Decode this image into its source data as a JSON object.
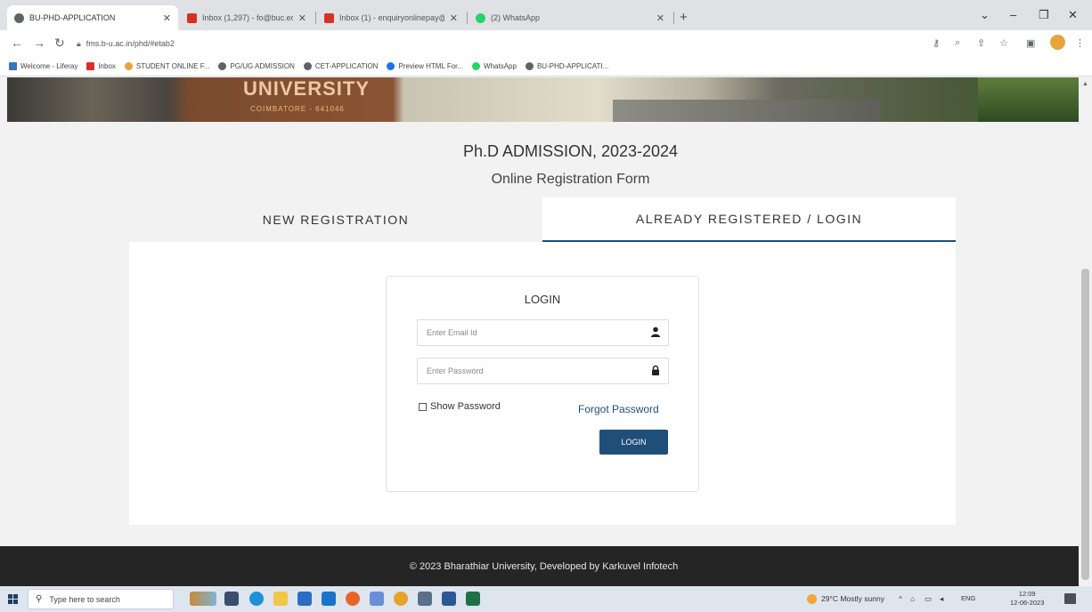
{
  "browser": {
    "tabs": [
      {
        "title": "BU-PHD-APPLICATION",
        "favicon_color": "#5f6368",
        "active": true
      },
      {
        "title": "Inbox (1,297) - fo@buc.edu.in - · ·",
        "favicon_color": "#d93025",
        "active": false
      },
      {
        "title": "Inbox (1) - enquiryonlinepay@b·",
        "favicon_color": "#d93025",
        "active": false
      },
      {
        "title": "(2) WhatsApp",
        "favicon_color": "#25d366",
        "active": false
      }
    ],
    "new_tab_label": "+",
    "url": "fms.b-u.ac.in/phd/#etab2",
    "bookmarks": [
      {
        "label": "Welcome - Liferay",
        "color": "#3b73b9"
      },
      {
        "label": "Inbox",
        "color": "#d93025"
      },
      {
        "label": "STUDENT ONLINE F...",
        "color": "#e8a33d"
      },
      {
        "label": "PG/UG ADMISSION",
        "color": "#5f6368"
      },
      {
        "label": "CET-APPLICATION",
        "color": "#5f6368"
      },
      {
        "label": "Preview HTML For...",
        "color": "#1a73e8"
      },
      {
        "label": "WhatsApp",
        "color": "#25d366"
      },
      {
        "label": "BU-PHD-APPLICATI...",
        "color": "#5f6368"
      }
    ]
  },
  "banner": {
    "university_word": "UNIVERSITY",
    "city": "COIMBATORE - 641046"
  },
  "page": {
    "heading": "Ph.D ADMISSION, 2023-2024",
    "subheading": "Online Registration Form",
    "tabs": {
      "new_registration": "NEW REGISTRATION",
      "login": "ALREADY REGISTERED / LOGIN"
    },
    "active_tab": "login",
    "login": {
      "title": "LOGIN",
      "email_placeholder": "Enter Email Id",
      "password_placeholder": "Enter Password",
      "show_password_label": "Show Password",
      "forgot_password_label": "Forgot Password",
      "submit_label": "LOGIN"
    },
    "footer": "© 2023 Bharathiar University, Developed by Karkuvel Infotech"
  },
  "taskbar": {
    "search_placeholder": "Type here to search",
    "weather": "29°C  Mostly sunny",
    "language": "ENG",
    "time": "12:09",
    "date": "12-06-2023"
  },
  "colors": {
    "accent": "#1f4e79",
    "footer_bg": "#252525"
  }
}
